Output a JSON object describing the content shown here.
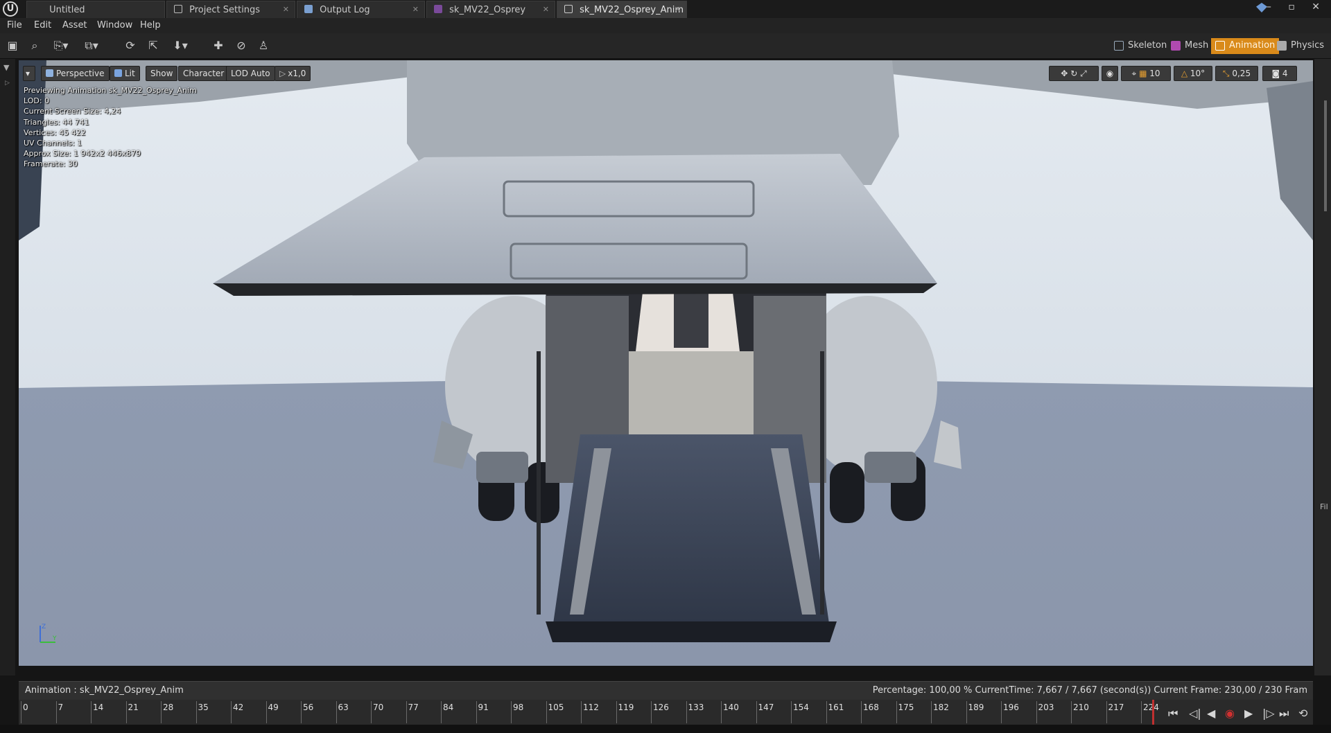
{
  "window": {
    "tabs": [
      {
        "label": "Untitled"
      },
      {
        "label": "Project Settings"
      },
      {
        "label": "Output Log"
      },
      {
        "label": "sk_MV22_Osprey"
      },
      {
        "label": "sk_MV22_Osprey_Anim"
      }
    ],
    "controls": "– ▫ ✕"
  },
  "menu": {
    "items": [
      "File",
      "Edit",
      "Asset",
      "Window",
      "Help"
    ]
  },
  "modes": [
    {
      "label": "Skeleton",
      "icon": "skeleton-icon"
    },
    {
      "label": "Mesh",
      "icon": "mesh-icon"
    },
    {
      "label": "Animation",
      "icon": "animation-icon",
      "active": true
    },
    {
      "label": "Physics",
      "icon": "physics-icon"
    }
  ],
  "viewport": {
    "buttons": {
      "perspective": "Perspective",
      "lit": "Lit",
      "show": "Show",
      "character": "Character",
      "lod": "LOD Auto",
      "speed": "x1,0"
    },
    "stats": [
      "Previewing Animation sk_MV22_Osprey_Anim",
      "LOD: 0",
      "Current Screen Size: 4,24",
      "Triangles: 44 741",
      "Vertices: 45 422",
      "UV Channels: 1",
      "Approx Size: 1 942x2 446x879",
      "Framerate: 30"
    ],
    "snap": {
      "grid": "10",
      "rotation": "10°",
      "scale": "0,25",
      "camera_speed": "4"
    }
  },
  "animation_bar": {
    "name": "Animation :  sk_MV22_Osprey_Anim",
    "status": "Percentage:  100,00 % CurrentTime:  7,667 / 7,667 (second(s)) Current Frame:  230,00 / 230 Fram"
  },
  "timeline": {
    "ticks": [
      "0",
      "7",
      "14",
      "21",
      "28",
      "35",
      "42",
      "49",
      "56",
      "63",
      "70",
      "77",
      "84",
      "91",
      "98",
      "105",
      "112",
      "119",
      "126",
      "133",
      "140",
      "147",
      "154",
      "161",
      "168",
      "175",
      "182",
      "189",
      "196",
      "203",
      "210",
      "217",
      "224"
    ]
  },
  "colors": {
    "accent": "#d98a1a",
    "sky": "#dde6ee",
    "ground": "#8b98ae"
  }
}
